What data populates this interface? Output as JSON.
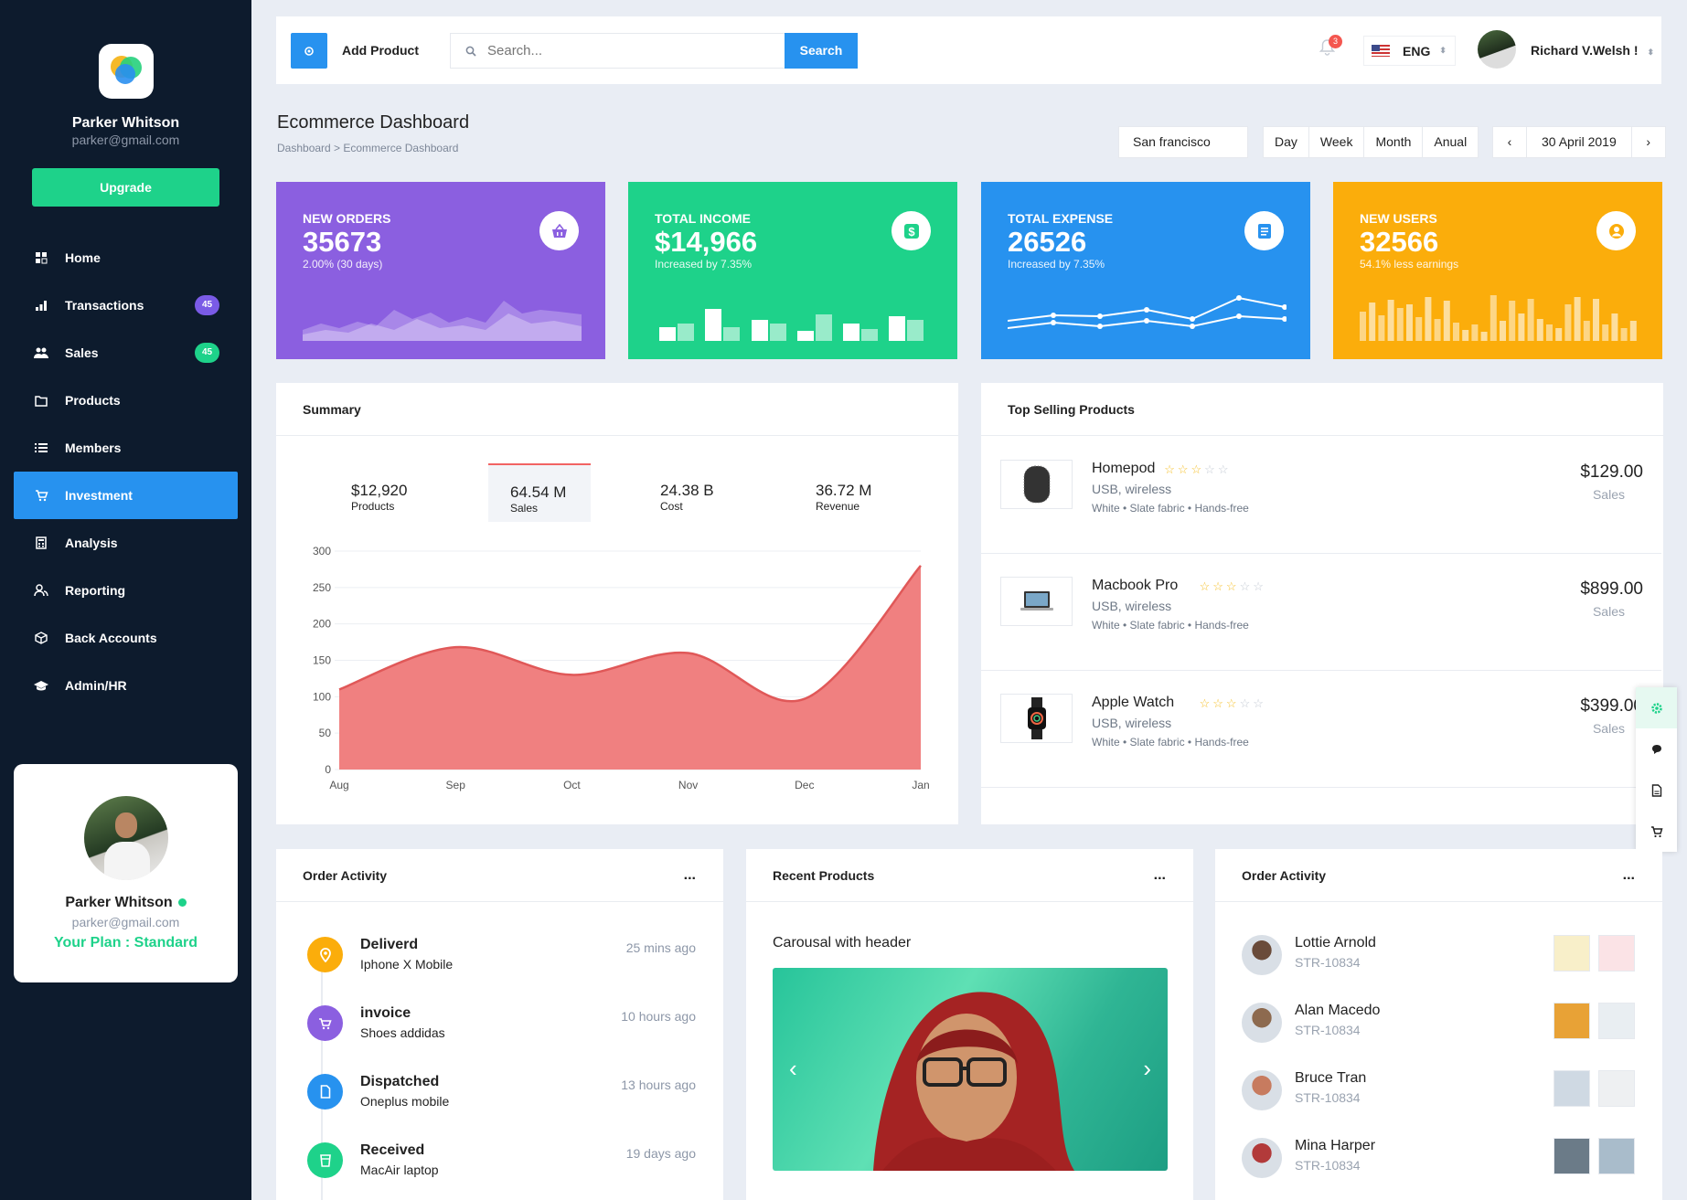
{
  "sidebar": {
    "user_name": "Parker Whitson",
    "user_email": "parker@gmail.com",
    "upgrade_label": "Upgrade",
    "items": [
      {
        "label": "Home",
        "icon": "home-icon"
      },
      {
        "label": "Transactions",
        "icon": "chart-icon",
        "badge": "45",
        "badge_color": "#7a5be6"
      },
      {
        "label": "Sales",
        "icon": "users-icon",
        "badge": "45",
        "badge_color": "#1ed28a"
      },
      {
        "label": "Products",
        "icon": "folder-icon"
      },
      {
        "label": "Members",
        "icon": "list-icon"
      },
      {
        "label": "Investment",
        "icon": "cart-icon",
        "active": true
      },
      {
        "label": "Analysis",
        "icon": "calculator-icon"
      },
      {
        "label": "Reporting",
        "icon": "user-group-icon"
      },
      {
        "label": "Back Accounts",
        "icon": "cube-icon"
      },
      {
        "label": "Admin/HR",
        "icon": "graduation-cap-icon"
      }
    ],
    "card": {
      "name": "Parker Whitson",
      "email": "parker@gmail.com",
      "plan": "Your Plan : Standard"
    }
  },
  "topbar": {
    "add_label": "Add Product",
    "search_placeholder": "Search...",
    "search_button": "Search",
    "notification_count": "3",
    "language": "ENG",
    "user_name": "Richard V.Welsh !"
  },
  "heading": {
    "title": "Ecommerce Dashboard",
    "breadcrumb": "Dashboard > Ecommerce Dashboard",
    "location": "San francisco",
    "periods": [
      "Day",
      "Week",
      "Month",
      "Anual"
    ],
    "date": "30 April 2019"
  },
  "stats": [
    {
      "label": "NEW ORDERS",
      "value": "35673",
      "sub": "2.00% (30 days)",
      "color": "#8b5fe0",
      "icon": "basket-icon"
    },
    {
      "label": "TOTAL INCOME",
      "value": "$14,966",
      "sub": "Increased by 7.35%",
      "color": "#1ed28a",
      "icon": "dollar-icon"
    },
    {
      "label": "TOTAL EXPENSE",
      "value": "26526",
      "sub": "Increased by 7.35%",
      "color": "#2792ef",
      "icon": "document-icon"
    },
    {
      "label": "NEW USERS",
      "value": "32566",
      "sub": "54.1% less earnings",
      "color": "#fbad0b",
      "icon": "user-circle-icon"
    }
  ],
  "summary": {
    "title": "Summary",
    "tabs": [
      {
        "value": "$12,920",
        "label": "Products"
      },
      {
        "value": "64.54 M",
        "label": "Sales",
        "active": true
      },
      {
        "value": "24.38 B",
        "label": "Cost"
      },
      {
        "value": "36.72 M",
        "label": "Revenue"
      }
    ]
  },
  "chart_data": {
    "type": "area",
    "categories": [
      "Aug",
      "Sep",
      "Oct",
      "Nov",
      "Dec",
      "Jan"
    ],
    "series": [
      {
        "values": [
          110,
          168,
          130,
          160,
          97,
          280
        ]
      }
    ],
    "ylim": [
      0,
      300
    ],
    "yticks": [
      0,
      50,
      100,
      150,
      200,
      250,
      300
    ],
    "color": "#f08080",
    "grid": true
  },
  "top_selling": {
    "title": "Top Selling Products",
    "products": [
      {
        "name": "Homepod",
        "rating": 3,
        "subtitle": "USB, wireless",
        "details": "White • Slate fabric • Hands-free",
        "price": "$129.00",
        "price_label": "Sales",
        "icon": "homepod-icon"
      },
      {
        "name": "Macbook Pro",
        "rating": 3,
        "subtitle": "USB, wireless",
        "details": "White • Slate fabric • Hands-free",
        "price": "$899.00",
        "price_label": "Sales",
        "icon": "laptop-icon"
      },
      {
        "name": "Apple Watch",
        "rating": 3,
        "subtitle": "USB, wireless",
        "details": "White • Slate fabric • Hands-free",
        "price": "$399.00",
        "price_label": "Sales",
        "icon": "watch-icon"
      }
    ]
  },
  "order_activity": {
    "title": "Order Activity",
    "menu": "...",
    "items": [
      {
        "title": "Deliverd",
        "desc": "Iphone X Mobile",
        "time": "25 mins ago",
        "color": "#fbad0b",
        "icon": "location-pin-icon"
      },
      {
        "title": "invoice",
        "desc": "Shoes addidas",
        "time": "10 hours ago",
        "color": "#8b5fe0",
        "icon": "cart-icon"
      },
      {
        "title": "Dispatched",
        "desc": "Oneplus mobile",
        "time": "13 hours ago",
        "color": "#2792ef",
        "icon": "file-icon"
      },
      {
        "title": "Received",
        "desc": "MacAir laptop",
        "time": "19 days ago",
        "color": "#1ed28a",
        "icon": "cup-icon"
      }
    ]
  },
  "recent_products": {
    "title": "Recent Products",
    "menu": "...",
    "carousel_title": "Carousal with header"
  },
  "order_activity_2": {
    "title": "Order Activity",
    "menu": "...",
    "items": [
      {
        "name": "Lottie Arnold",
        "code": "STR-10834"
      },
      {
        "name": "Alan Macedo",
        "code": "STR-10834"
      },
      {
        "name": "Bruce Tran",
        "code": "STR-10834"
      },
      {
        "name": "Mina Harper",
        "code": "STR-10834"
      }
    ]
  },
  "floatbar": [
    "gear-icon",
    "chat-icon",
    "document-icon",
    "cart-icon"
  ]
}
